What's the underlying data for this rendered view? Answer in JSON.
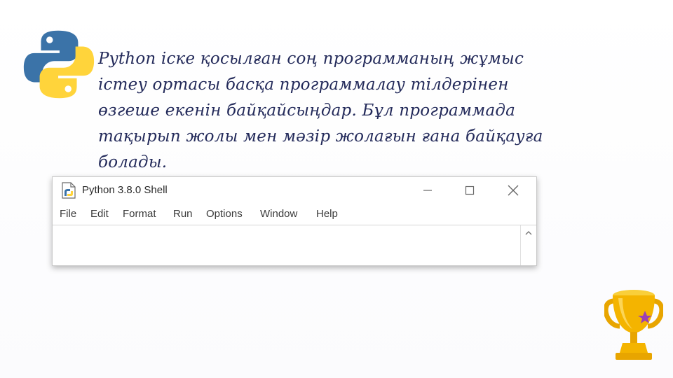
{
  "slide": {
    "paragraph": "Python іске қосылған соң программаның жұмыс істеу ортасы басқа программалау тілдерінен өзгеше екенін байқайсыңдар. Бұл программада тақырып жолы мен мәзір жолағын ғана байқауға болады."
  },
  "window": {
    "title": "Python 3.8.0 Shell",
    "menu": [
      "File",
      "Edit",
      "Format",
      "Run",
      "Options",
      "Window",
      "Help"
    ]
  },
  "colors": {
    "text": "#232a5a",
    "python_blue": "#3b73a8",
    "python_yellow": "#ffd43b",
    "trophy_gold": "#f4b400",
    "star": "#9b3fb5"
  },
  "icons": {
    "logo": "python-logo",
    "app": "python-file-icon",
    "minimize": "minimize-icon",
    "maximize": "maximize-icon",
    "close": "close-icon",
    "scroll_up": "chevron-up-icon",
    "trophy": "trophy-icon"
  }
}
